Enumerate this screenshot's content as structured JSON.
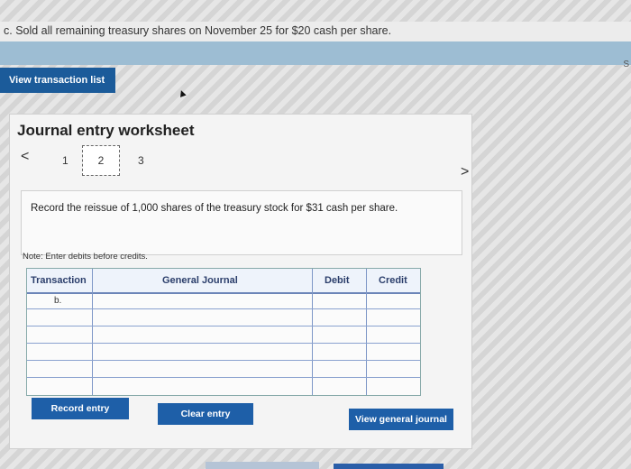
{
  "instruction_line": "c. Sold all remaining treasury shares on November 25 for $20 cash per share.",
  "edge_letter": "S",
  "view_transaction_list": "View transaction list",
  "worksheet": {
    "title": "Journal entry worksheet",
    "prev": "<",
    "next": ">",
    "steps": [
      "1",
      "2",
      "3"
    ],
    "active_step": "2",
    "instruction": "Record the reissue of 1,000 shares of the treasury stock for $31 cash per share.",
    "note": "Note: Enter debits before credits."
  },
  "journal": {
    "headers": {
      "transaction": "Transaction",
      "general_journal": "General Journal",
      "debit": "Debit",
      "credit": "Credit"
    },
    "first_row_transaction": "b."
  },
  "buttons": {
    "record_entry": "Record entry",
    "clear_entry": "Clear entry",
    "view_general_journal": "View general journal"
  }
}
